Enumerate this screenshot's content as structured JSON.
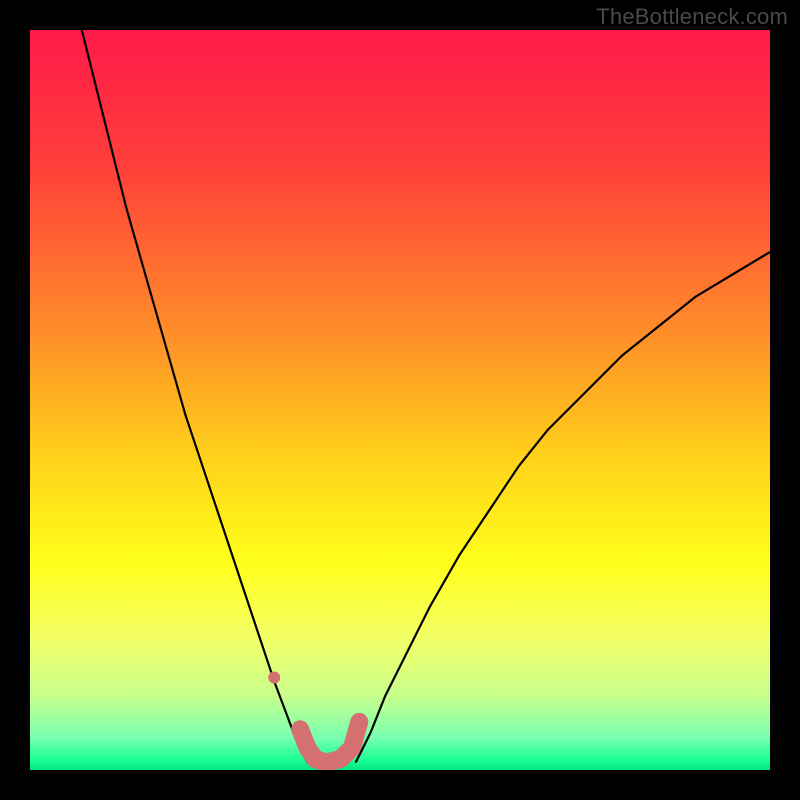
{
  "watermark": "TheBottleneck.com",
  "chart_data": {
    "type": "line",
    "title": "",
    "xlabel": "",
    "ylabel": "",
    "xlim": [
      0,
      100
    ],
    "ylim": [
      0,
      100
    ],
    "grid": false,
    "legend": false,
    "gradient_stops": [
      {
        "offset": 0.0,
        "color": "#ff1a49"
      },
      {
        "offset": 0.18,
        "color": "#ff3e3a"
      },
      {
        "offset": 0.4,
        "color": "#ff8a2a"
      },
      {
        "offset": 0.58,
        "color": "#ffd21a"
      },
      {
        "offset": 0.72,
        "color": "#ffff1a"
      },
      {
        "offset": 0.82,
        "color": "#f4ff66"
      },
      {
        "offset": 0.9,
        "color": "#c7ff8c"
      },
      {
        "offset": 0.955,
        "color": "#7cffb0"
      },
      {
        "offset": 0.985,
        "color": "#21ff98"
      },
      {
        "offset": 1.0,
        "color": "#00e884"
      }
    ],
    "series": [
      {
        "name": "left-curve",
        "stroke": "#000000",
        "stroke_width": 2.2,
        "x": [
          7,
          9,
          11,
          13,
          15,
          17,
          19,
          21,
          23,
          25,
          27,
          29,
          31,
          33,
          34.5,
          36,
          37.5
        ],
        "y": [
          100,
          92,
          84,
          76,
          69,
          62,
          55,
          48,
          42,
          36,
          30,
          24,
          18,
          12,
          8,
          4,
          1
        ]
      },
      {
        "name": "right-curve",
        "stroke": "#000000",
        "stroke_width": 2.2,
        "x": [
          44,
          46,
          48,
          51,
          54,
          58,
          62,
          66,
          70,
          75,
          80,
          85,
          90,
          95,
          100
        ],
        "y": [
          1,
          5,
          10,
          16,
          22,
          29,
          35,
          41,
          46,
          51,
          56,
          60,
          64,
          67,
          70
        ]
      },
      {
        "name": "bottom-u-thick",
        "stroke": "#d47070",
        "stroke_width": 18,
        "linecap": "round",
        "x": [
          36.5,
          37.5,
          38.5,
          40,
          42,
          43.5,
          44.5
        ],
        "y": [
          5.5,
          3.0,
          1.5,
          1.0,
          1.5,
          3.0,
          6.5
        ]
      }
    ],
    "markers": [
      {
        "name": "left-dot",
        "x": 33.0,
        "y": 12.5,
        "r": 6,
        "fill": "#d47070"
      }
    ]
  }
}
